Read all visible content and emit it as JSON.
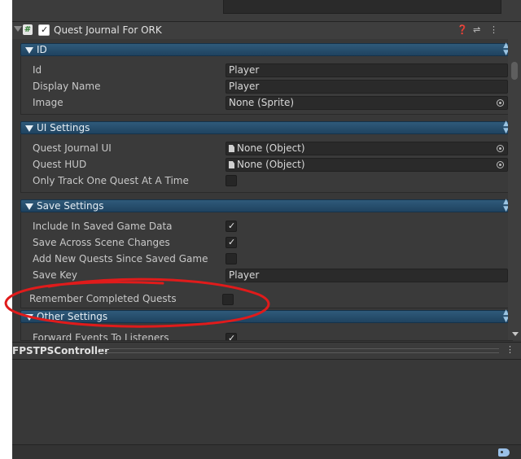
{
  "component": {
    "title": "Quest Journal For ORK",
    "enabled": true
  },
  "sections": {
    "id": {
      "title": "ID",
      "rows": [
        {
          "label": "Id",
          "value": "Player"
        },
        {
          "label": "Display Name",
          "value": "Player"
        },
        {
          "label": "Image",
          "value": "None (Sprite)"
        }
      ]
    },
    "ui": {
      "title": "UI Settings",
      "rows": [
        {
          "label": "Quest Journal UI",
          "value": "None (Object)"
        },
        {
          "label": "Quest HUD",
          "value": "None (Object)"
        },
        {
          "label": "Only Track One Quest At A Time",
          "checked": false
        }
      ]
    },
    "save": {
      "title": "Save Settings",
      "rows": [
        {
          "label": "Include In Saved Game Data",
          "checked": true
        },
        {
          "label": "Save Across Scene Changes",
          "checked": true
        },
        {
          "label": "Add New Quests Since Saved Game",
          "checked": false
        },
        {
          "label": "Save Key",
          "value": "Player"
        },
        {
          "label": "Remember Completed Quests",
          "checked": false
        }
      ]
    },
    "other": {
      "title": "Other Settings",
      "rows": [
        {
          "label": "Forward Events To Listeners",
          "checked": true
        }
      ]
    }
  },
  "next_component": {
    "title": "FPSTPSController"
  },
  "icons": {
    "script": "script-icon",
    "help": "help-icon",
    "presets": "presets-icon",
    "menu": "kebab-menu-icon",
    "picker": "object-picker-icon",
    "tag": "tag-icon"
  },
  "colors": {
    "inspector_bg": "#383838",
    "section_header": "#1f4360",
    "annotation": "#e01b1b"
  }
}
